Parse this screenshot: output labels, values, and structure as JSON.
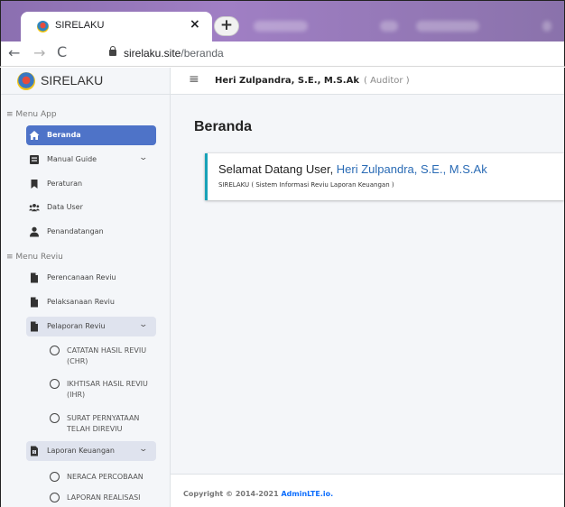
{
  "browser": {
    "tab_title": "SIRELAKU",
    "tab_close": "×",
    "new_tab": "+",
    "url_host": "sirelaku.site",
    "url_path": "/beranda"
  },
  "sidebar": {
    "brand": "SIRELAKU",
    "section_app": "≡ Menu App",
    "section_reviu": "≡ Menu Reviu",
    "items": [
      {
        "label": "Beranda",
        "icon": "home-icon"
      },
      {
        "label": "Manual Guide",
        "icon": "book-icon"
      },
      {
        "label": "Peraturan",
        "icon": "bookmark-icon"
      },
      {
        "label": "Data User",
        "icon": "users-icon"
      },
      {
        "label": "Penandatangan",
        "icon": "user-icon"
      },
      {
        "label": "Perencanaan Reviu",
        "icon": "file-icon"
      },
      {
        "label": "Pelaksanaan Reviu",
        "icon": "file-icon"
      },
      {
        "label": "Pelaporan Reviu",
        "icon": "file-icon"
      },
      {
        "label": "Laporan Keuangan",
        "icon": "file-invoice-icon"
      }
    ],
    "sub_pelaporan": [
      "CATATAN HASIL REVIU (CHR)",
      "IKHTISAR HASIL REVIU (IHR)",
      "SURAT PERNYATAAN TELAH DIREVIU"
    ],
    "sub_laporan": [
      "NERACA PERCOBAAN",
      "LAPORAN REALISASI"
    ]
  },
  "topnav": {
    "menu_icon": "≡",
    "user_name": "Heri Zulpandra, S.E., M.S.Ak",
    "user_role": "( Auditor )"
  },
  "content": {
    "page_title": "Beranda",
    "welcome_prefix": "Selamat Datang User, ",
    "welcome_name": "Heri Zulpandra, S.E., M.S.Ak",
    "welcome_sub": "SIRELAKU ( Sistem Informasi Reviu Laporan Keuangan )"
  },
  "footer": {
    "copyright": "Copyright © 2014-2021 ",
    "link": "AdminLTE.io."
  },
  "colors": {
    "active_item": "#4e73c8",
    "card_accent": "#17a2b8",
    "link": "#2a6bb5"
  }
}
